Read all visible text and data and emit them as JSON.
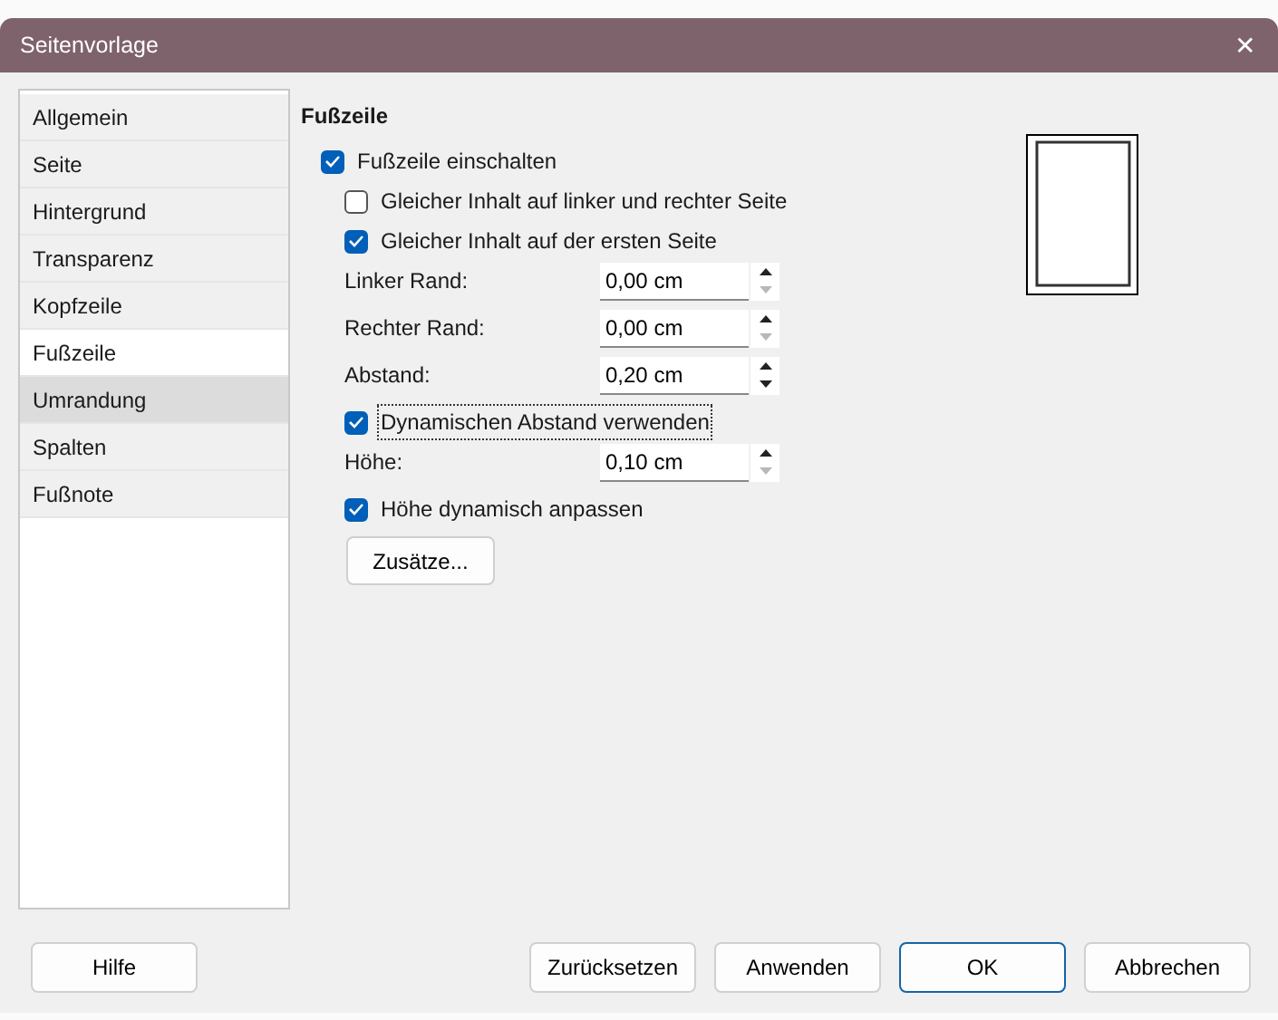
{
  "window": {
    "title": "Seitenvorlage",
    "close": "✕"
  },
  "sidebar": {
    "items": [
      {
        "label": "Allgemein",
        "selected": false,
        "hovered": false
      },
      {
        "label": "Seite",
        "selected": false,
        "hovered": false
      },
      {
        "label": "Hintergrund",
        "selected": false,
        "hovered": false
      },
      {
        "label": "Transparenz",
        "selected": false,
        "hovered": false
      },
      {
        "label": "Kopfzeile",
        "selected": false,
        "hovered": false
      },
      {
        "label": "Fußzeile",
        "selected": true,
        "hovered": false
      },
      {
        "label": "Umrandung",
        "selected": false,
        "hovered": true
      },
      {
        "label": "Spalten",
        "selected": false,
        "hovered": false
      },
      {
        "label": "Fußnote",
        "selected": false,
        "hovered": false
      }
    ]
  },
  "section": {
    "title": "Fußzeile",
    "rows": [
      {
        "kind": "checkbox",
        "label": "Fußzeile einschalten",
        "checked": true,
        "indent": false,
        "focused": false
      },
      {
        "kind": "checkbox",
        "label": "Gleicher Inhalt auf linker und rechter Seite",
        "checked": false,
        "indent": true,
        "focused": false
      },
      {
        "kind": "checkbox",
        "label": "Gleicher Inhalt auf der ersten Seite",
        "checked": true,
        "indent": true,
        "focused": false
      },
      {
        "kind": "spin",
        "label": "Linker Rand:",
        "value": "0,00 cm",
        "down_disabled": true
      },
      {
        "kind": "spin",
        "label": "Rechter Rand:",
        "value": "0,00 cm",
        "down_disabled": true
      },
      {
        "kind": "spin",
        "label": "Abstand:",
        "value": "0,20 cm",
        "down_disabled": false
      },
      {
        "kind": "checkbox",
        "label": "Dynamischen Abstand verwenden",
        "checked": true,
        "indent": true,
        "focused": true
      },
      {
        "kind": "spin",
        "label": "Höhe:",
        "value": "0,10 cm",
        "down_disabled": true
      },
      {
        "kind": "checkbox",
        "label": "Höhe dynamisch anpassen",
        "checked": true,
        "indent": true,
        "focused": false
      },
      {
        "kind": "button",
        "label": "Zusätze..."
      }
    ]
  },
  "help_button": {
    "label": "Hilfe"
  },
  "buttons": [
    {
      "label": "Zurücksetzen",
      "default": false
    },
    {
      "label": "Anwenden",
      "default": false
    },
    {
      "label": "OK",
      "default": true
    },
    {
      "label": "Abbrechen",
      "default": false
    }
  ]
}
